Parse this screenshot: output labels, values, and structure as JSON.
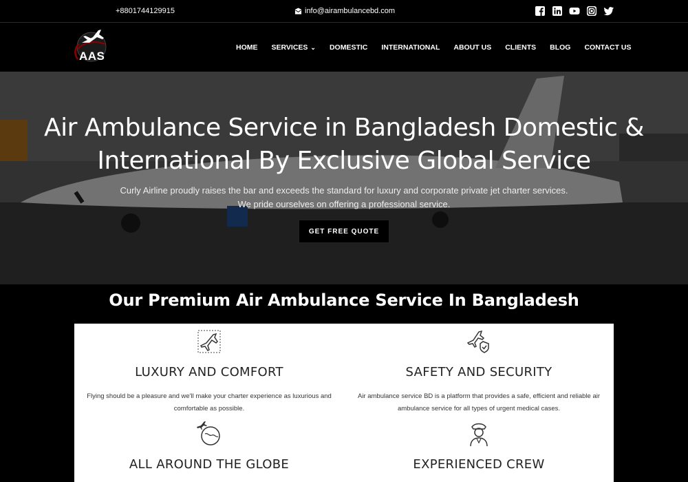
{
  "topbar": {
    "phone": "+8801744129915",
    "email": "info@airambulancebd.com",
    "email_icon": "envelope-icon",
    "social": [
      "facebook-icon",
      "linkedin-icon",
      "youtube-icon",
      "instagram-icon",
      "twitter-icon"
    ]
  },
  "logo": {
    "text": "AAS",
    "icon": "airplane-globe-logo"
  },
  "nav": {
    "home": "HOME",
    "services": "SERVICES",
    "domestic": "DOMESTIC",
    "international": "INTERNATIONAL",
    "about": "ABOUT US",
    "clients": "CLIENTS",
    "blog": "BLOG",
    "contact": "CONTACT US"
  },
  "hero": {
    "title_line1": "Air Ambulance Service in Bangladesh Domestic &",
    "title_line2": "International By Exclusive Global Service",
    "sub_line1": "Curly Airline proudly raises the bar and exceeds the standard for luxury and corporate private jet charter services.",
    "sub_line2": "We pride ourselves on offering a professional service.",
    "cta": "GET FREE QUOTE"
  },
  "section": {
    "title": "Our Premium Air Ambulance Service In Bangladesh",
    "features": [
      {
        "icon": "airplane-icon",
        "title": "LUXURY AND COMFORT",
        "text": "Flying should be a pleasure and we'll make your charter experience as luxurious and comfortable as possible."
      },
      {
        "icon": "airplane-shield-icon",
        "title": "SAFETY AND SECURITY",
        "text": "Air ambulance service BD is a platform that provides a safe, efficient and reliable air ambulance service for all types of urgent medical cases."
      },
      {
        "icon": "globe-airplane-icon",
        "title": "ALL AROUND THE GLOBE",
        "text": ""
      },
      {
        "icon": "pilot-icon",
        "title": "EXPERIENCED CREW",
        "text": ""
      }
    ]
  },
  "colors": {
    "background": "#000000",
    "panel": "#ffffff",
    "text_dark": "#222222"
  }
}
